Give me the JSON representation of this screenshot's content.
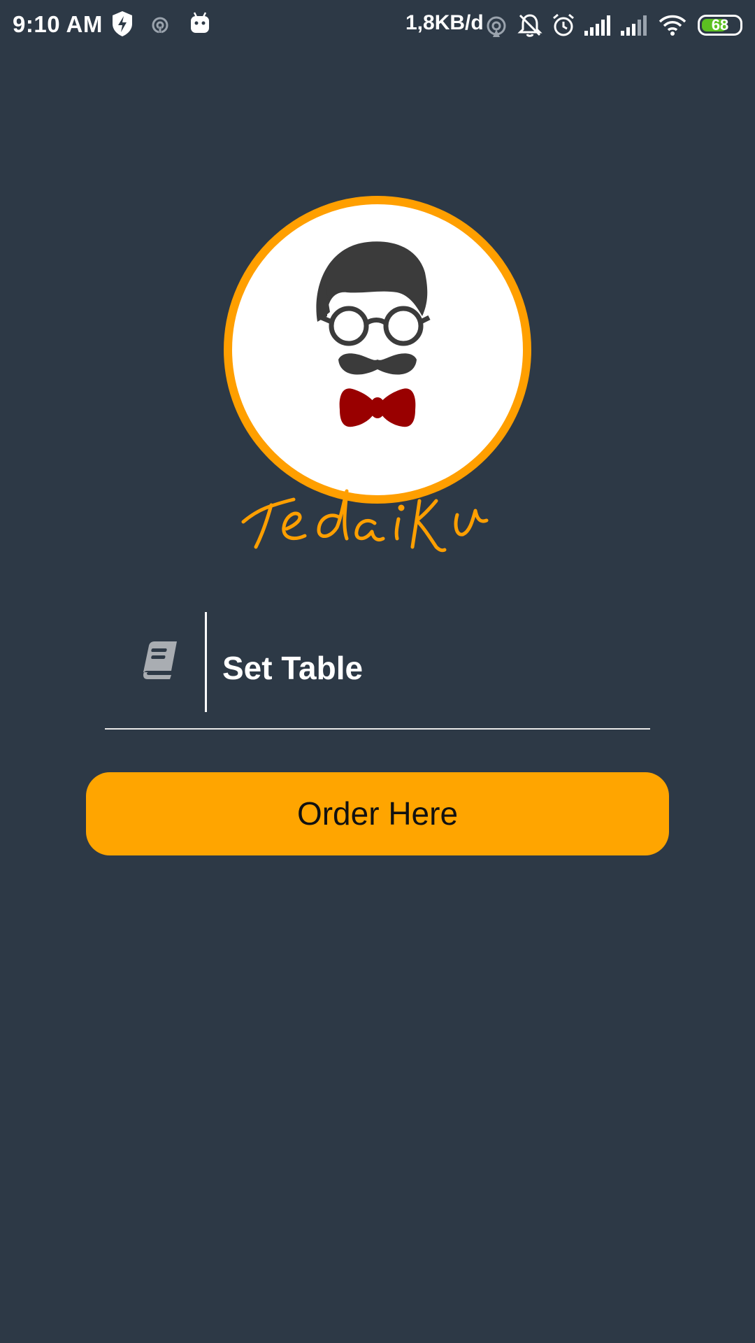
{
  "status_bar": {
    "time": "9:10 AM",
    "network_speed": "1,8KB/d",
    "battery_level": "68",
    "battery_fraction": 0.68,
    "icons": [
      "shield-bolt-icon",
      "hotspot-icon",
      "android-icon",
      "sync-icon",
      "silent-bell-icon",
      "alarm-icon",
      "signal-icon",
      "signal-icon",
      "wifi-icon",
      "battery-icon"
    ]
  },
  "logo": {
    "wordmark": "TedaiKu",
    "ring_color": "#ff9f00",
    "bowtie_color": "#990000"
  },
  "table_field": {
    "placeholder": "Set Table",
    "value": "",
    "icon": "book-icon"
  },
  "order_button": {
    "label": "Order Here",
    "color": "#ffa500"
  },
  "colors": {
    "background": "#2d3946",
    "accent": "#ffa500"
  }
}
